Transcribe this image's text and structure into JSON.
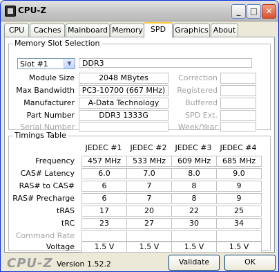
{
  "window": {
    "title": "CPU-Z"
  },
  "title_buttons": {
    "minimize": "_",
    "maximize": "□",
    "close": "✕"
  },
  "tabs": [
    {
      "label": "CPU"
    },
    {
      "label": "Caches"
    },
    {
      "label": "Mainboard"
    },
    {
      "label": "Memory"
    },
    {
      "label": "SPD"
    },
    {
      "label": "Graphics"
    },
    {
      "label": "About"
    }
  ],
  "memory_slot": {
    "group_title": "Memory Slot Selection",
    "slot_selected": "Slot #1",
    "type": "DDR3",
    "labels": {
      "module_size": "Module Size",
      "max_bandwidth": "Max Bandwidth",
      "manufacturer": "Manufacturer",
      "part_number": "Part Number",
      "serial_number": "Serial Number",
      "correction": "Correction",
      "registered": "Registered",
      "buffered": "Buffered",
      "spd_ext": "SPD Ext.",
      "week_year": "Week/Year"
    },
    "values": {
      "module_size": "2048 MBytes",
      "max_bandwidth": "PC3-10700 (667 MHz)",
      "manufacturer": "A-Data Technology",
      "part_number": "DDR3 1333G",
      "serial_number": "",
      "correction": "",
      "registered": "",
      "buffered": "",
      "spd_ext": "",
      "week_year": ""
    }
  },
  "timings": {
    "group_title": "Timings Table",
    "columns": [
      "JEDEC #1",
      "JEDEC #2",
      "JEDEC #3",
      "JEDEC #4"
    ],
    "rows": [
      {
        "label": "Frequency",
        "values": [
          "457 MHz",
          "533 MHz",
          "609 MHz",
          "685 MHz"
        ]
      },
      {
        "label": "CAS# Latency",
        "values": [
          "6.0",
          "7.0",
          "8.0",
          "9.0"
        ]
      },
      {
        "label": "RAS# to CAS#",
        "values": [
          "6",
          "7",
          "8",
          "9"
        ]
      },
      {
        "label": "RAS# Precharge",
        "values": [
          "6",
          "7",
          "8",
          "9"
        ]
      },
      {
        "label": "tRAS",
        "values": [
          "17",
          "20",
          "22",
          "25"
        ]
      },
      {
        "label": "tRC",
        "values": [
          "23",
          "27",
          "30",
          "34"
        ]
      },
      {
        "label": "Command Rate",
        "values": [
          "",
          "",
          "",
          ""
        ]
      },
      {
        "label": "Voltage",
        "values": [
          "1.5 V",
          "1.5 V",
          "1.5 V",
          "1.5 V"
        ]
      }
    ]
  },
  "footer": {
    "logo": "CPU-Z",
    "version": "Version 1.52.2",
    "validate_label": "Validate",
    "ok_label": "OK"
  }
}
